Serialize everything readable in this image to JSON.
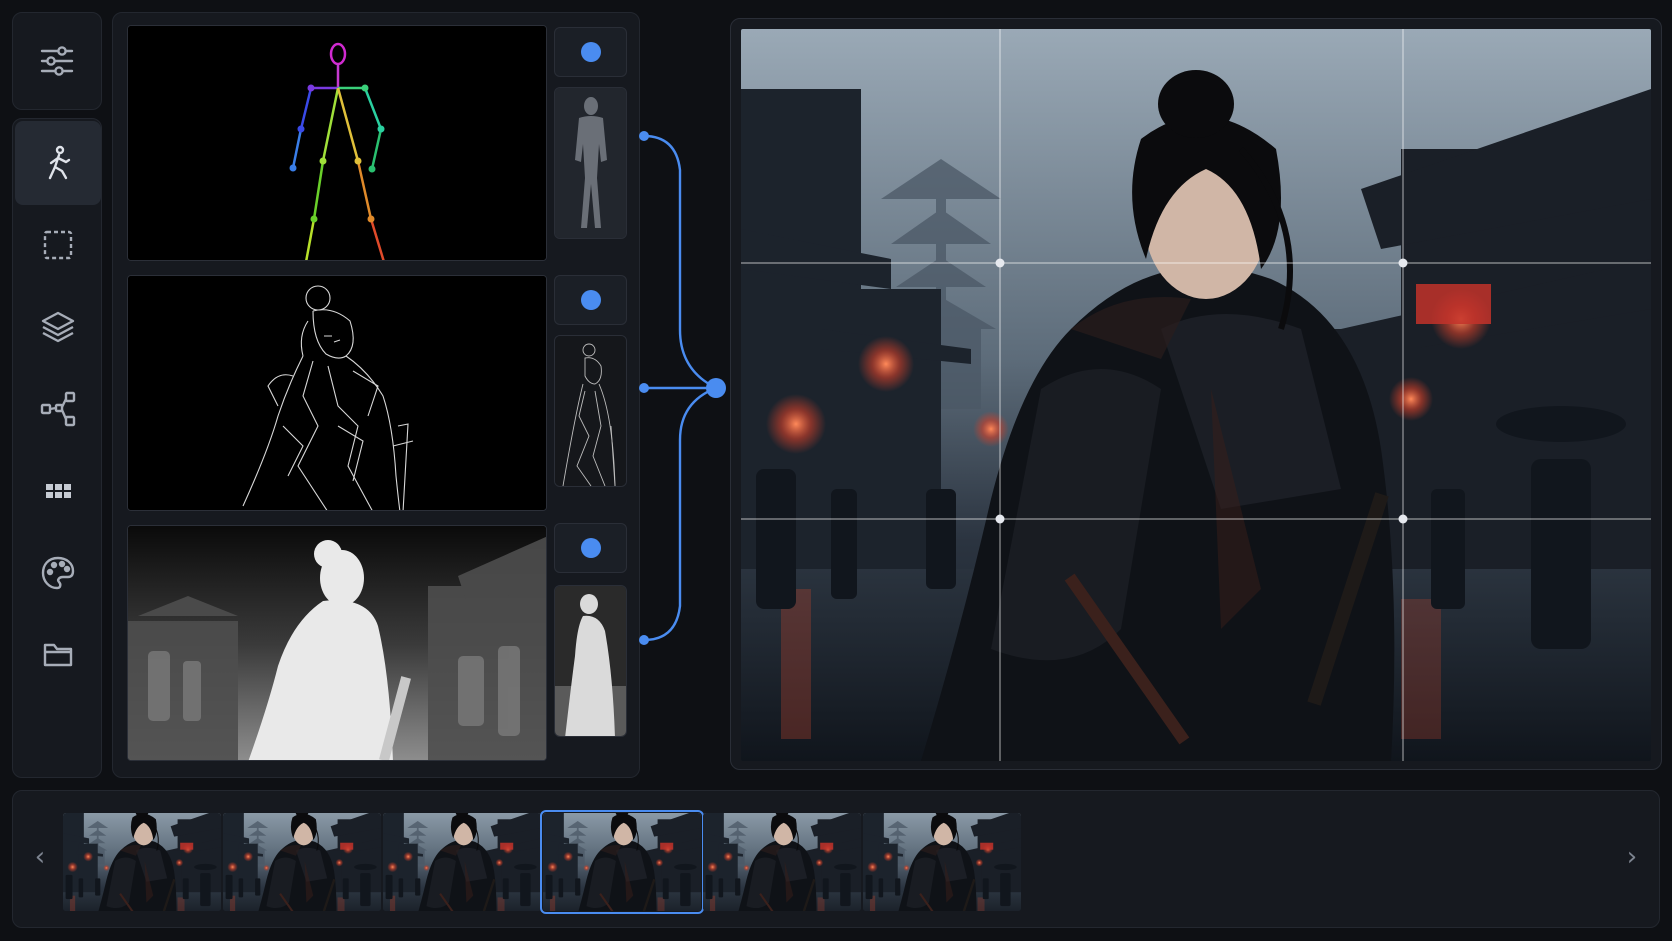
{
  "toolbar": {
    "top_icon": "sliders-icon",
    "items": [
      {
        "icon": "pose-icon",
        "active": true
      },
      {
        "icon": "select-icon",
        "active": false
      },
      {
        "icon": "layers-icon",
        "active": false
      },
      {
        "icon": "nodes-icon",
        "active": false
      },
      {
        "icon": "grid-icon",
        "active": false
      },
      {
        "icon": "palette-icon",
        "active": false
      },
      {
        "icon": "folder-icon",
        "active": false
      }
    ]
  },
  "controlnets": [
    {
      "type": "pose",
      "enabled": true
    },
    {
      "type": "lineart",
      "enabled": true
    },
    {
      "type": "depth",
      "enabled": true
    }
  ],
  "preview": {
    "composition_grid": "rule-of-thirds"
  },
  "filmstrip": {
    "prev_icon": "chevron-left-icon",
    "next_icon": "chevron-right-icon",
    "prev_glyph": "‹",
    "next_glyph": "›",
    "frame_count": 6,
    "selected_index": 3
  },
  "colors": {
    "accent": "#4a8cf0",
    "panel": "#16191f",
    "background": "#0e1014"
  }
}
